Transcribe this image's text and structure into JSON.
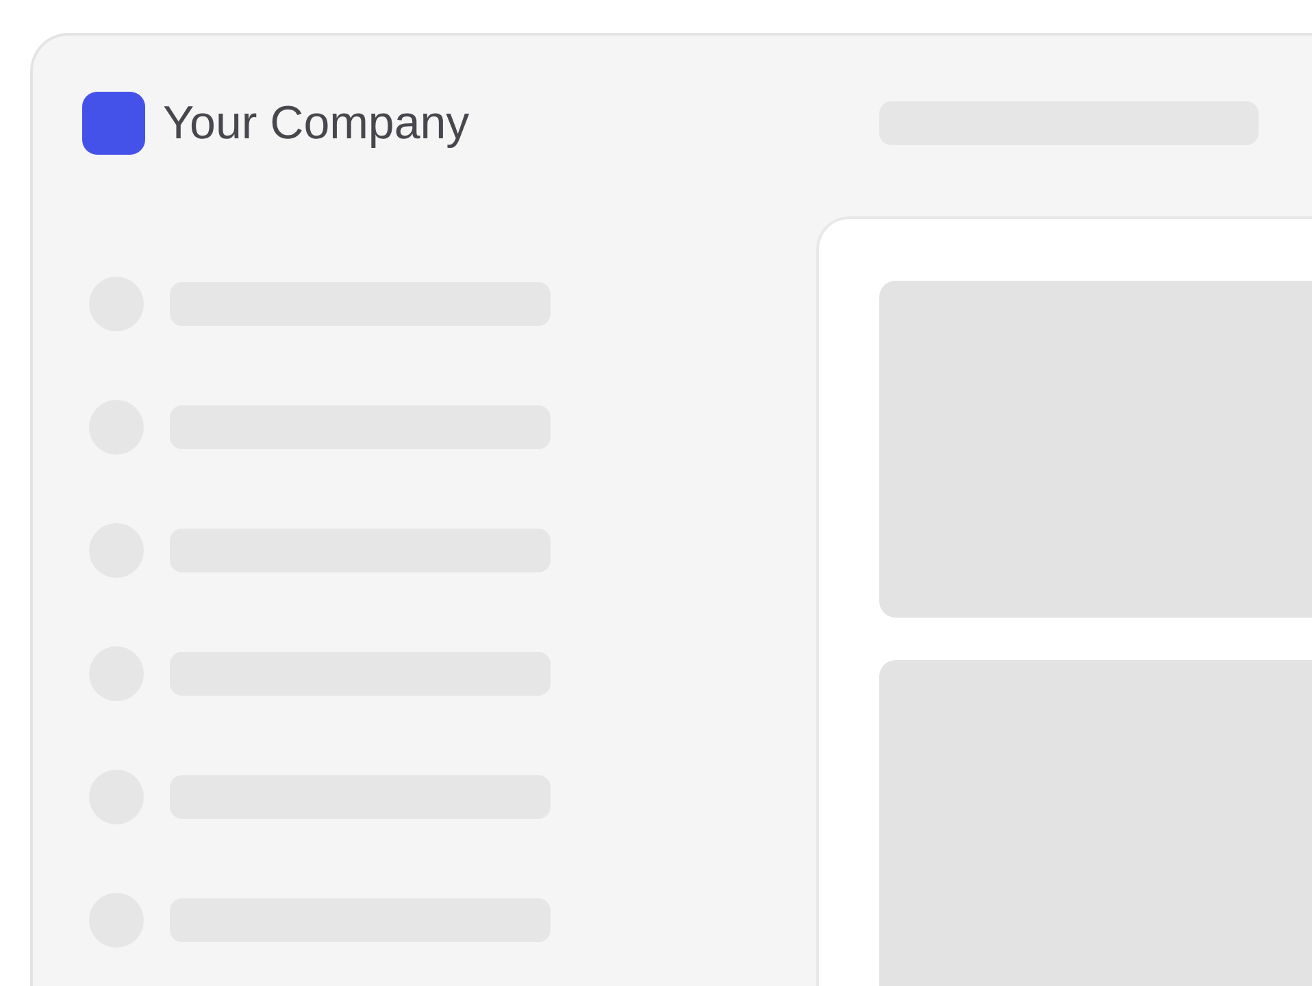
{
  "header": {
    "brand": "Your Company"
  }
}
